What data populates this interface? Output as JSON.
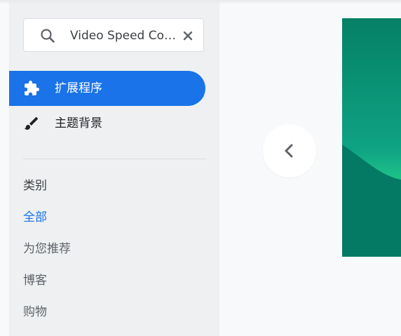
{
  "search": {
    "value": "Video Speed Controller"
  },
  "nav": {
    "items": [
      {
        "label": "扩展程序",
        "icon": "puzzle-icon"
      },
      {
        "label": "主题背景",
        "icon": "brush-icon"
      }
    ]
  },
  "categories": {
    "heading": "类别",
    "items": [
      "全部",
      "为您推荐",
      "博客",
      "购物"
    ],
    "selected": "全部"
  },
  "carousel": {
    "prev_icon": "chevron-left-icon"
  },
  "colors": {
    "accent": "#1a73e8",
    "sidebar_bg": "#eef0f2",
    "page_bg": "#f8f9fa",
    "banner_dark": "#058066",
    "banner_light": "#22c98a"
  }
}
